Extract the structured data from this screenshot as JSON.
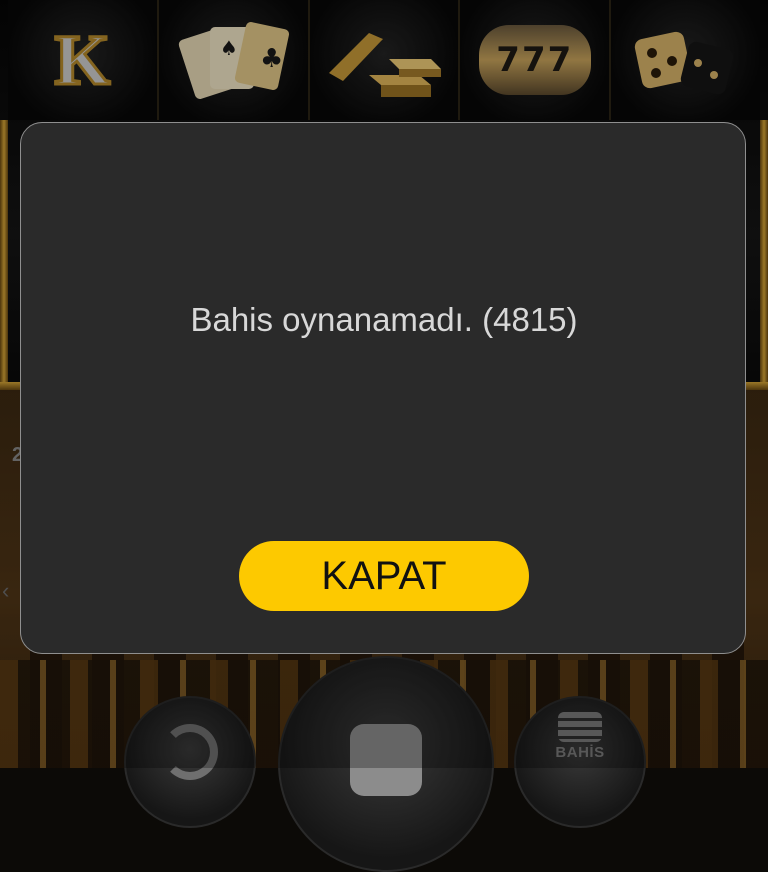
{
  "reels": {
    "symbols": [
      {
        "name": "king-symbol",
        "text": "K"
      },
      {
        "name": "playing-cards-symbol",
        "text": ""
      },
      {
        "name": "gold-bars-symbol",
        "text": ""
      },
      {
        "name": "slot-machine-symbol",
        "text": "777"
      },
      {
        "name": "dice-symbol",
        "text": ""
      }
    ]
  },
  "controls": {
    "bet_label": "BAHİS"
  },
  "dialog": {
    "message": "Bahis oynanamadı. (4815)",
    "close_label": "KAPAT"
  },
  "colors": {
    "accent": "#fdc900",
    "dialog_bg": "#2a2a2a",
    "dialog_border": "#8f8f8f",
    "message_text": "#d8d8d8"
  }
}
